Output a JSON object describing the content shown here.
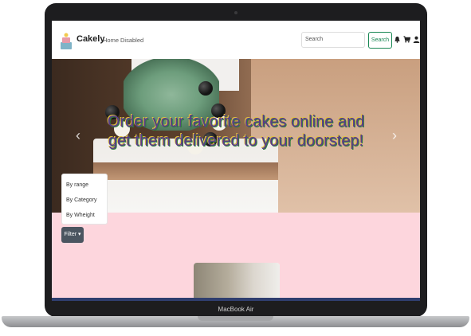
{
  "device": {
    "model_label": "MacBook Air"
  },
  "navbar": {
    "brand": "Cakely",
    "links": [
      "Home",
      "Disabled"
    ],
    "search_placeholder": "Search",
    "search_button": "Search",
    "icons": [
      "bell-icon",
      "cart-icon",
      "user-icon"
    ]
  },
  "hero": {
    "caption_line1": "Order your favorite cakes online and",
    "caption_line2": "get them delivered to your doorstep!",
    "prev_glyph": "‹",
    "next_glyph": "›"
  },
  "filter": {
    "button_label": "Filter",
    "options": [
      "By range",
      "By Category",
      "By Wheight"
    ]
  },
  "colors": {
    "pink_section": "#fdd6dd",
    "search_green": "#198754",
    "filter_button": "#4b5560"
  }
}
